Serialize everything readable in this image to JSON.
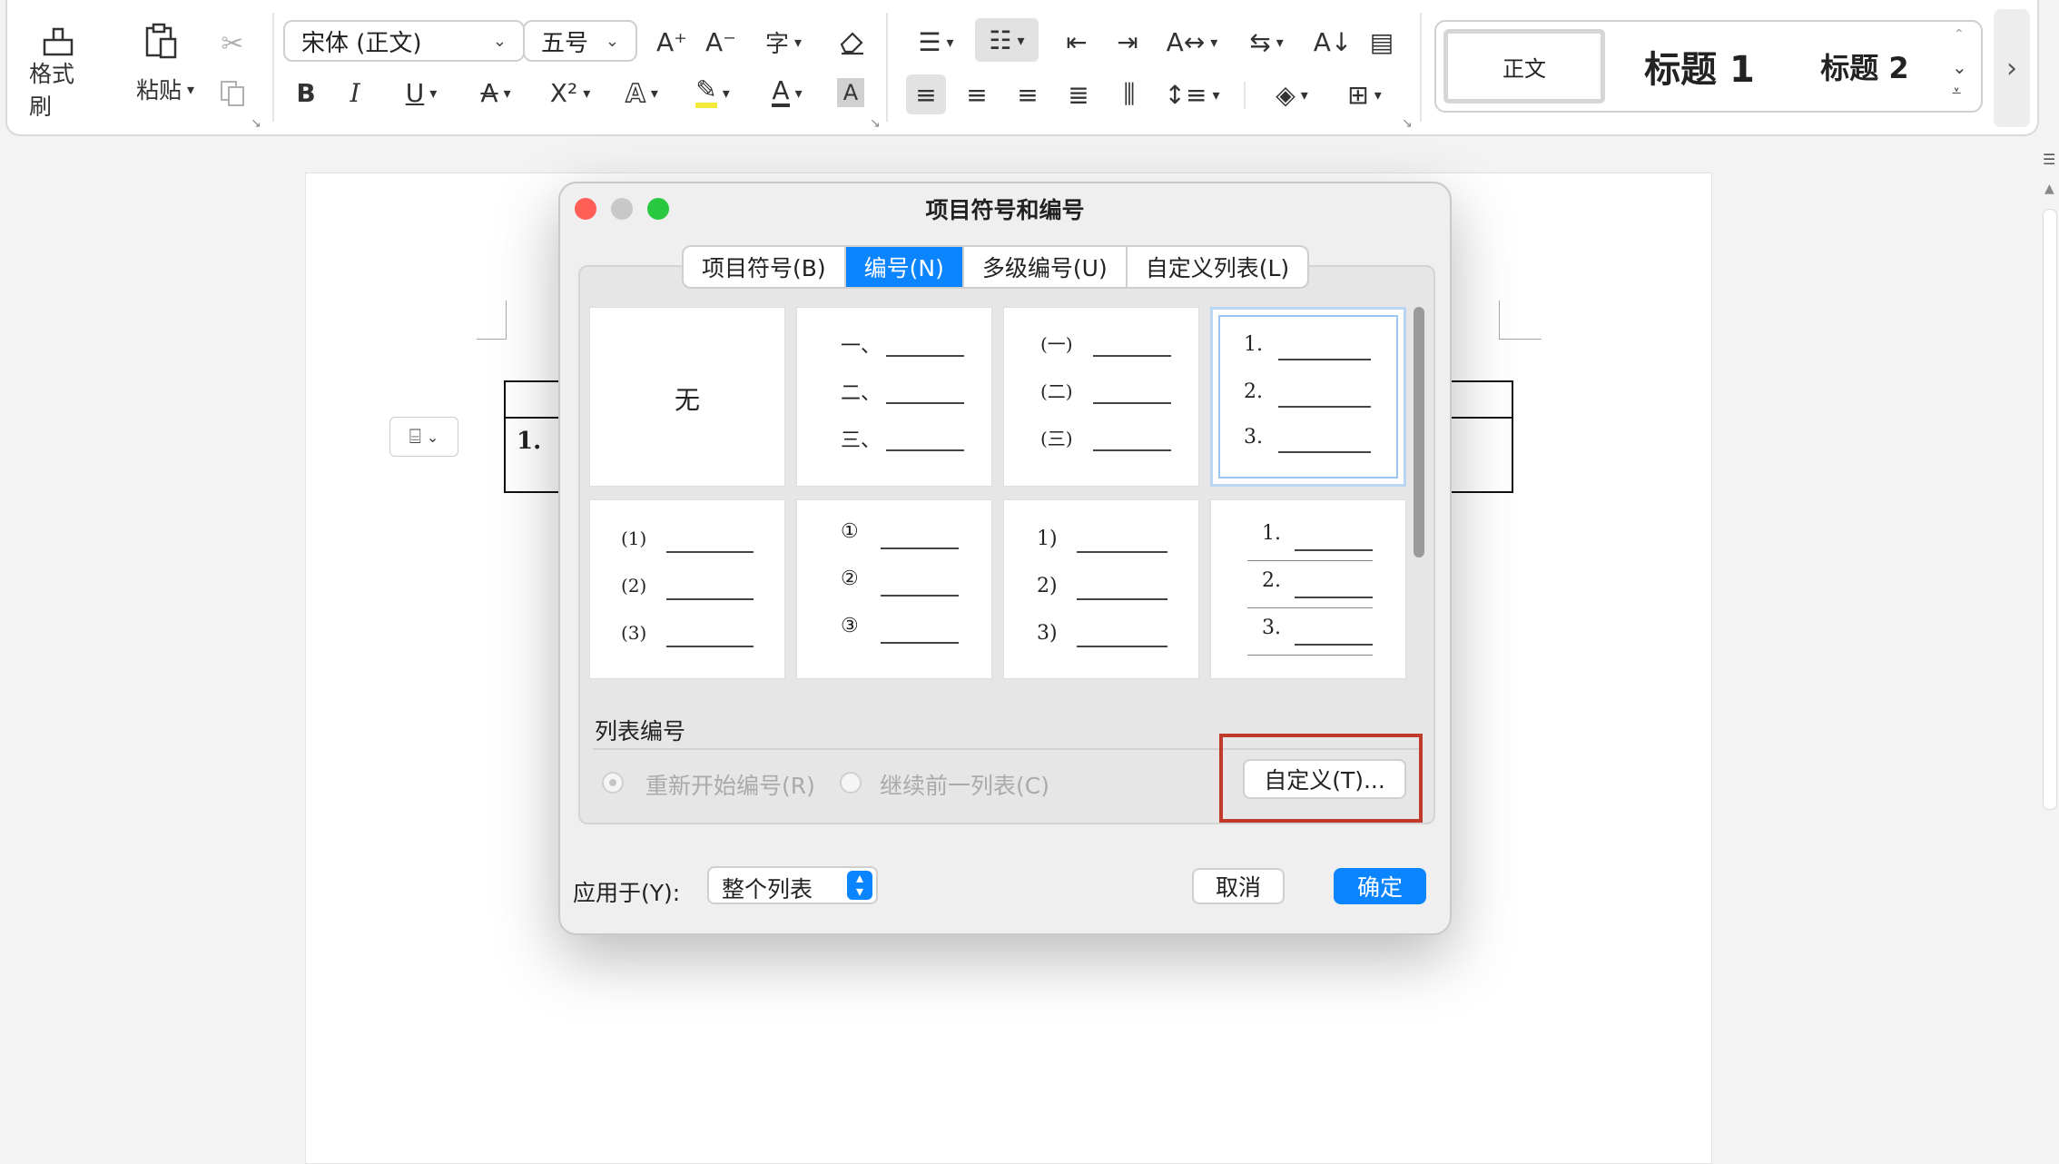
{
  "ribbon": {
    "format_painter": "格式刷",
    "paste": "粘贴",
    "font_name": "宋体 (正文)",
    "font_size": "五号",
    "grow_font": "A⁺",
    "shrink_font": "A⁻",
    "bold": "B",
    "italic": "I",
    "underline": "U",
    "superscript": "X²",
    "font_color_a": "A",
    "char_shade": "A",
    "styles": {
      "normal": "正文",
      "heading1": "标题 1",
      "heading2": "标题 2"
    }
  },
  "document": {
    "list_marker": "1."
  },
  "dialog": {
    "title": "项目符号和编号",
    "tabs": [
      "项目符号(B)",
      "编号(N)",
      "多级编号(U)",
      "自定义列表(L)"
    ],
    "active_tab": "编号(N)",
    "presets": {
      "none": "无",
      "chinese": [
        "一、",
        "二、",
        "三、"
      ],
      "chinese_paren": [
        "(一)",
        "(二)",
        "(三)"
      ],
      "decimal": [
        "1.",
        "2.",
        "3."
      ],
      "paren": [
        "(1)",
        "(2)",
        "(3)"
      ],
      "circled": [
        "①",
        "②",
        "③"
      ],
      "right_paren": [
        "1)",
        "2)",
        "3)"
      ],
      "decimal_indent": [
        "1.",
        "2.",
        "3."
      ]
    },
    "list_numbering_label": "列表编号",
    "restart_label": "重新开始编号(R)",
    "continue_label": "继续前一列表(C)",
    "customize_button": "自定义(T)...",
    "apply_to_label": "应用于(Y):",
    "apply_to_value": "整个列表",
    "cancel": "取消",
    "ok": "确定"
  },
  "colors": {
    "accent": "#0a84ff",
    "highlight_box": "#c0392b",
    "close": "#ff5f57",
    "zoom": "#28c840"
  }
}
